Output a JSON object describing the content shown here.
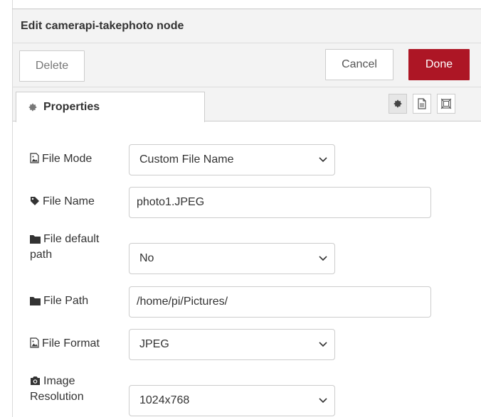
{
  "header": {
    "title": "Edit camerapi-takephoto node"
  },
  "toolbar": {
    "delete_label": "Delete",
    "cancel_label": "Cancel",
    "done_label": "Done"
  },
  "tabs": {
    "properties_label": "Properties"
  },
  "form": {
    "file_mode": {
      "label": "File Mode",
      "value": "Custom File Name",
      "icon": "image-file-icon"
    },
    "file_name": {
      "label": "File Name",
      "value": "photo1.JPEG",
      "icon": "tag-icon"
    },
    "file_default_path": {
      "label_line1": "File default",
      "label_line2": "path",
      "value": "No",
      "icon": "folder-icon"
    },
    "file_path": {
      "label": "File Path",
      "value": "/home/pi/Pictures/",
      "icon": "folder-icon"
    },
    "file_format": {
      "label": "File Format",
      "value": "JPEG",
      "icon": "image-file-icon"
    },
    "image_resolution": {
      "label_line1": "Image",
      "label_line2": "Resolution",
      "value": "1024x768",
      "icon": "camera-icon"
    }
  },
  "colors": {
    "done_button": "#ad1625",
    "tray_background": "#f3f3f3"
  }
}
